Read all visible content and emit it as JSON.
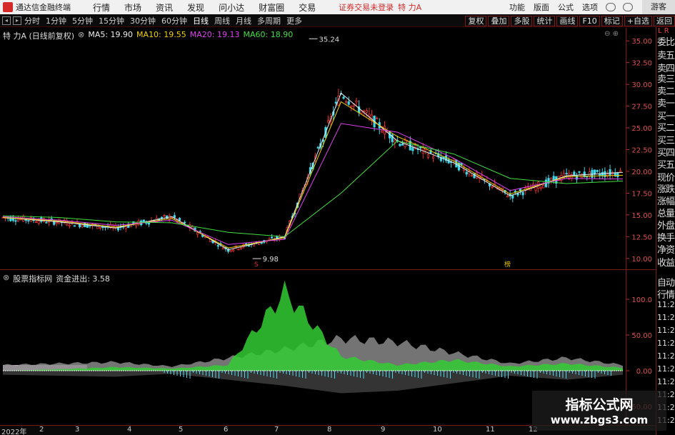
{
  "app": {
    "title": "通达信金融终端",
    "menu": [
      "行情",
      "市场",
      "资讯",
      "发现",
      "问小达",
      "财富圈",
      "交易"
    ],
    "login_notice": "证券交易未登录",
    "stock_name": "特 力A",
    "right_menu": [
      "功能",
      "版面",
      "公式",
      "选项"
    ],
    "guest": "游客"
  },
  "toolbar": {
    "periods": [
      "分时",
      "1分钟",
      "5分钟",
      "15分钟",
      "30分钟",
      "60分钟",
      "日线",
      "周线",
      "月线",
      "多周期",
      "更多"
    ],
    "active_period": "日线",
    "tools": [
      "复权",
      "叠加",
      "多股",
      "统计",
      "画线",
      "F10",
      "标记",
      "+自选",
      "返回"
    ]
  },
  "main_chart": {
    "legend_name": "特 力A (日线前复权)",
    "ma_labels": [
      "MA5: 19.90",
      "MA10: 19.55",
      "MA20: 19.13",
      "MA60: 18.90"
    ],
    "high_label": "35.24",
    "low_label": "9.98",
    "marker_s": "S",
    "marker_tag": "榜"
  },
  "indicator": {
    "name": "股票指标网",
    "value_label": "资金进出: 3.58"
  },
  "side_panel": {
    "lr": "L R",
    "items": [
      "委比",
      "卖五",
      "卖四",
      "卖三",
      "卖二",
      "卖一",
      "买一",
      "买二",
      "买三",
      "买四",
      "买五",
      "现价",
      "涨跌",
      "涨幅",
      "总量",
      "外盘",
      "换手",
      "净资",
      "收益",
      "自动",
      "行情"
    ],
    "times": [
      "11:2",
      "11:2",
      "11:2",
      "11:2",
      "11:2",
      "11:2",
      "11:2",
      "11:2",
      "11:2",
      "11:2"
    ]
  },
  "date_axis": [
    "2022年",
    "2",
    "3",
    "4",
    "5",
    "6",
    "7",
    "8",
    "9",
    "10",
    "11",
    "12"
  ],
  "watermark": {
    "line1": "指标公式网",
    "line2": "www.zbgs3.com"
  },
  "chart_data": [
    {
      "type": "line",
      "title": "特 力A (日线前复权)",
      "y_ticks": [
        "35.00",
        "32.50",
        "30.00",
        "27.50",
        "25.00",
        "22.50",
        "20.00",
        "17.50",
        "15.00",
        "12.50",
        "10.00"
      ],
      "ylim": [
        9.0,
        36.0
      ],
      "x": [
        "2022-01",
        "2022-02",
        "2022-03",
        "2022-04",
        "2022-05",
        "2022-06",
        "2022-07",
        "2022-08",
        "2022-09",
        "2022-10",
        "2022-11",
        "2022-12"
      ],
      "series": [
        {
          "name": "MA5",
          "color": "#eeeeee",
          "values": [
            14.7,
            14.2,
            13.5,
            14.8,
            11.0,
            12.5,
            29.0,
            23.5,
            21.0,
            17.2,
            19.5,
            19.9
          ]
        },
        {
          "name": "MA10",
          "color": "#f0d000",
          "values": [
            14.7,
            14.3,
            13.6,
            14.6,
            11.2,
            12.4,
            28.0,
            24.0,
            21.2,
            17.4,
            19.4,
            19.55
          ]
        },
        {
          "name": "MA20",
          "color": "#e040f0",
          "values": [
            14.8,
            14.4,
            13.8,
            14.4,
            11.6,
            12.2,
            25.5,
            24.5,
            21.5,
            17.8,
            19.2,
            19.13
          ]
        },
        {
          "name": "MA60",
          "color": "#40e040",
          "values": [
            14.9,
            14.7,
            14.2,
            14.1,
            13.0,
            12.5,
            17.5,
            23.5,
            22.0,
            19.2,
            18.6,
            18.9
          ]
        }
      ],
      "annotations": [
        {
          "text": "35.24",
          "x": "2022-06"
        },
        {
          "text": "9.98",
          "x": "2022-05"
        }
      ]
    },
    {
      "type": "area",
      "title": "资金进出: 3.58",
      "y_ticks": [
        "100.0",
        "50.00",
        "0.00",
        "-50.00"
      ],
      "ylim": [
        -70,
        130
      ],
      "x": [
        "2022-01",
        "2022-02",
        "2022-03",
        "2022-04",
        "2022-05",
        "2022-06",
        "2022-07",
        "2022-08",
        "2022-09",
        "2022-10",
        "2022-11",
        "2022-12"
      ],
      "series": [
        {
          "name": "green",
          "color": "#33cc33",
          "values": [
            0,
            2,
            5,
            3,
            8,
            110,
            20,
            8,
            15,
            6,
            10,
            4
          ]
        },
        {
          "name": "gray",
          "color": "#888888",
          "values": [
            8,
            10,
            12,
            6,
            18,
            30,
            45,
            40,
            25,
            10,
            18,
            8
          ]
        }
      ]
    }
  ]
}
